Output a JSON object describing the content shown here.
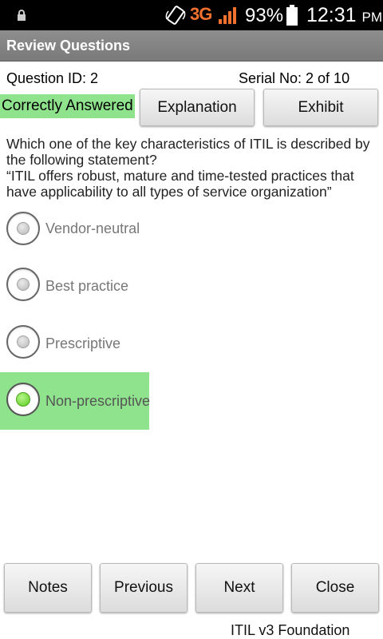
{
  "status_bar": {
    "network": "3G",
    "battery": "93%",
    "time": "12:31",
    "ampm": "PM",
    "icons": [
      "lock-icon",
      "rotate-icon",
      "signal-icon",
      "battery-icon"
    ]
  },
  "header": {
    "title": "Review Questions"
  },
  "question_info": {
    "id_label": "Question ID: 2",
    "serial_label": "Serial No: 2 of 10"
  },
  "status": {
    "label": "Correctly Answered",
    "color": "#8fe38c"
  },
  "actions": {
    "explanation": "Explanation",
    "exhibit": "Exhibit"
  },
  "question": {
    "line1": "Which one of the key characteristics of ITIL is described by the following statement?",
    "line2": "“ITIL offers robust, mature and time-tested practices that have applicability to all types of service organization”"
  },
  "options": [
    {
      "label": "Vendor-neutral",
      "selected": false
    },
    {
      "label": "Best practice",
      "selected": false
    },
    {
      "label": "Prescriptive",
      "selected": false
    },
    {
      "label": "Non-prescriptive",
      "selected": true
    }
  ],
  "nav": {
    "notes": "Notes",
    "previous": "Previous",
    "next": "Next",
    "close": "Close"
  },
  "footer": {
    "label": "ITIL v3 Foundation"
  }
}
